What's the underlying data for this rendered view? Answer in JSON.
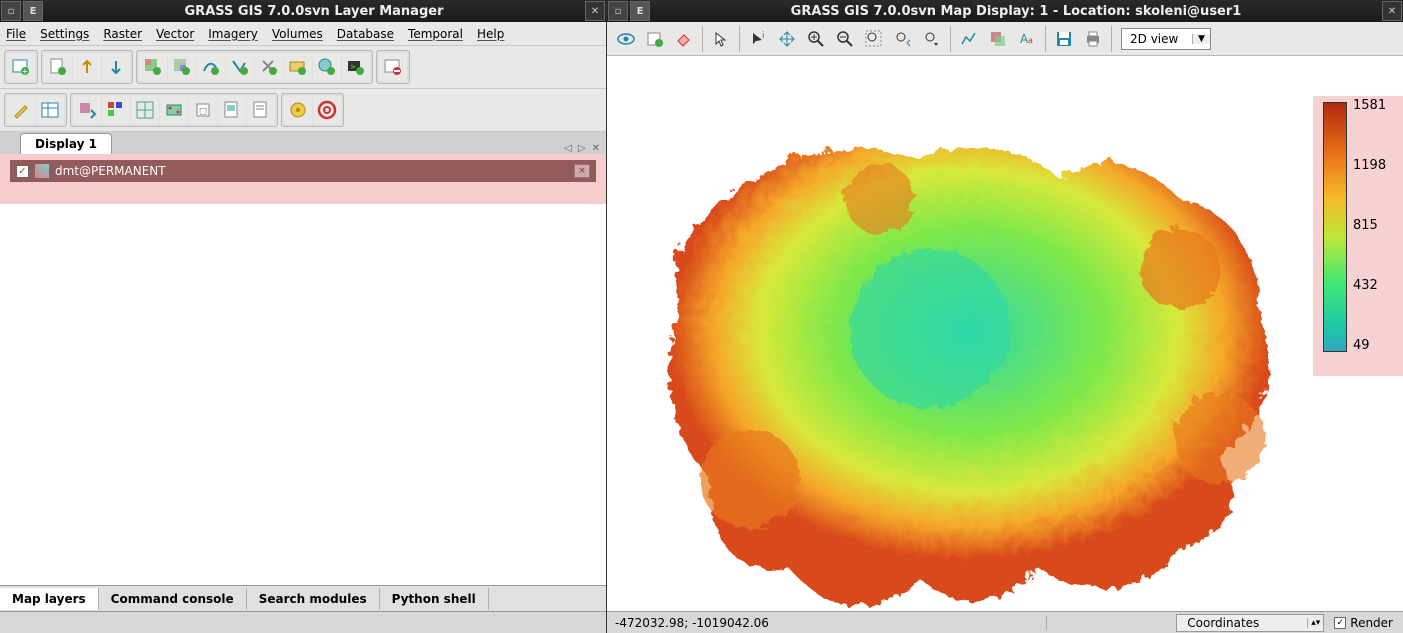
{
  "left_window": {
    "title": "GRASS GIS 7.0.0svn Layer Manager",
    "menu": [
      "File",
      "Settings",
      "Raster",
      "Vector",
      "Imagery",
      "Volumes",
      "Database",
      "Temporal",
      "Help"
    ],
    "display_tab": "Display 1",
    "layer": "dmt@PERMANENT",
    "bottom_tabs": [
      "Map layers",
      "Command console",
      "Search modules",
      "Python shell"
    ]
  },
  "right_window": {
    "title": "GRASS GIS 7.0.0svn Map Display: 1  - Location: skoleni@user1",
    "view_mode": "2D view",
    "coordinates": "-472032.98; -1019042.06",
    "status_combo": "Coordinates",
    "render_label": "Render",
    "legend": {
      "ticks": [
        "1581",
        "1198",
        "815",
        "432",
        "49"
      ]
    }
  }
}
